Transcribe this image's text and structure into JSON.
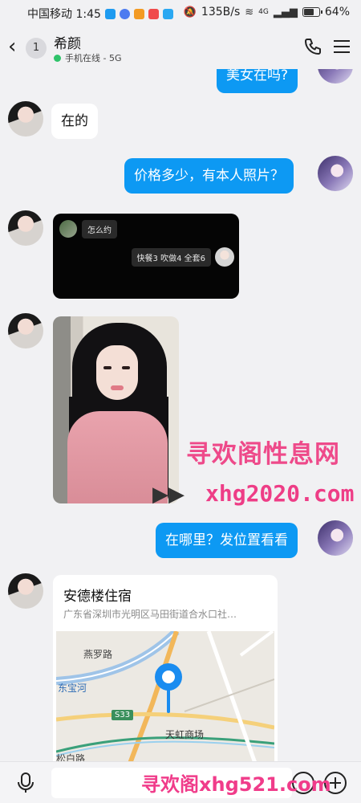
{
  "status_bar": {
    "carrier_time": "中国移动 1:45",
    "net_speed": "135B/s",
    "signal_text": "4G",
    "battery_text": "64%",
    "battery_level": 0.64
  },
  "header": {
    "back_glyph": "‹",
    "unread_count": "1",
    "contact_name": "希颜",
    "online_status": "手机在线 - 5G"
  },
  "messages": {
    "top_partial": "美女在吗?",
    "m1_text": "在的",
    "m2_text": "价格多少，有本人照片？",
    "card_question": "怎么约",
    "card_prices": "快餐3  吹做4  全套6",
    "m4_text": "在哪里？发位置看看"
  },
  "location": {
    "title": "安德楼住宿",
    "address": "广东省深圳市光明区马田街道合水口社…",
    "map_labels": {
      "road1": "燕罗路",
      "river": "东宝河",
      "highway": "S33",
      "mall": "天虹商场",
      "road2": "松白路"
    }
  },
  "watermarks": {
    "title": "寻欢阁性息网",
    "site1": "xhg2020.com",
    "site2": "寻欢阁xhg521.com"
  },
  "colors": {
    "accent_blue": "#0d99f3",
    "online_green": "#2fc36a",
    "watermark_pink": "#ee4a8a"
  }
}
